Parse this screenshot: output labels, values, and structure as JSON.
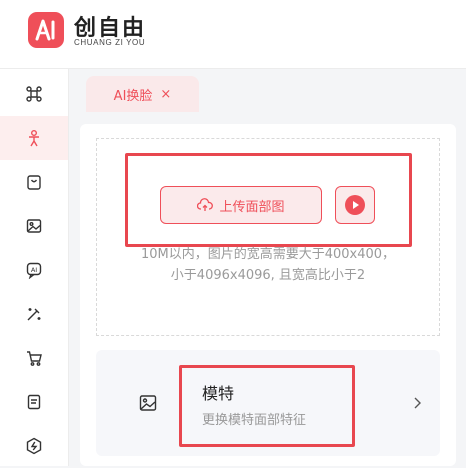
{
  "brand": {
    "name_cn": "创自由",
    "name_en": "CHUANG ZI YOU"
  },
  "colors": {
    "accent": "#ef4f59",
    "accent_light": "#fbeaeb",
    "highlight": "#e8474f"
  },
  "sidebar": {
    "items": [
      {
        "icon": "command-icon",
        "active": false
      },
      {
        "icon": "person-icon",
        "active": true
      },
      {
        "icon": "bag-icon",
        "active": false
      },
      {
        "icon": "image-icon",
        "active": false
      },
      {
        "icon": "ai-chat-icon",
        "active": false
      },
      {
        "icon": "magic-wand-icon",
        "active": false
      },
      {
        "icon": "cart-icon",
        "active": false
      },
      {
        "icon": "document-icon",
        "active": false
      },
      {
        "icon": "lightning-icon",
        "active": false
      }
    ]
  },
  "tab": {
    "label": "AI换脸",
    "close": "×"
  },
  "upload": {
    "button_label": "上传面部图",
    "hint_line1": "10M以内，图片的宽高需要大于400x400，",
    "hint_line2": "小于4096x4096, 且宽高比小于2"
  },
  "model": {
    "title": "模特",
    "subtitle": "更换模特面部特征"
  }
}
